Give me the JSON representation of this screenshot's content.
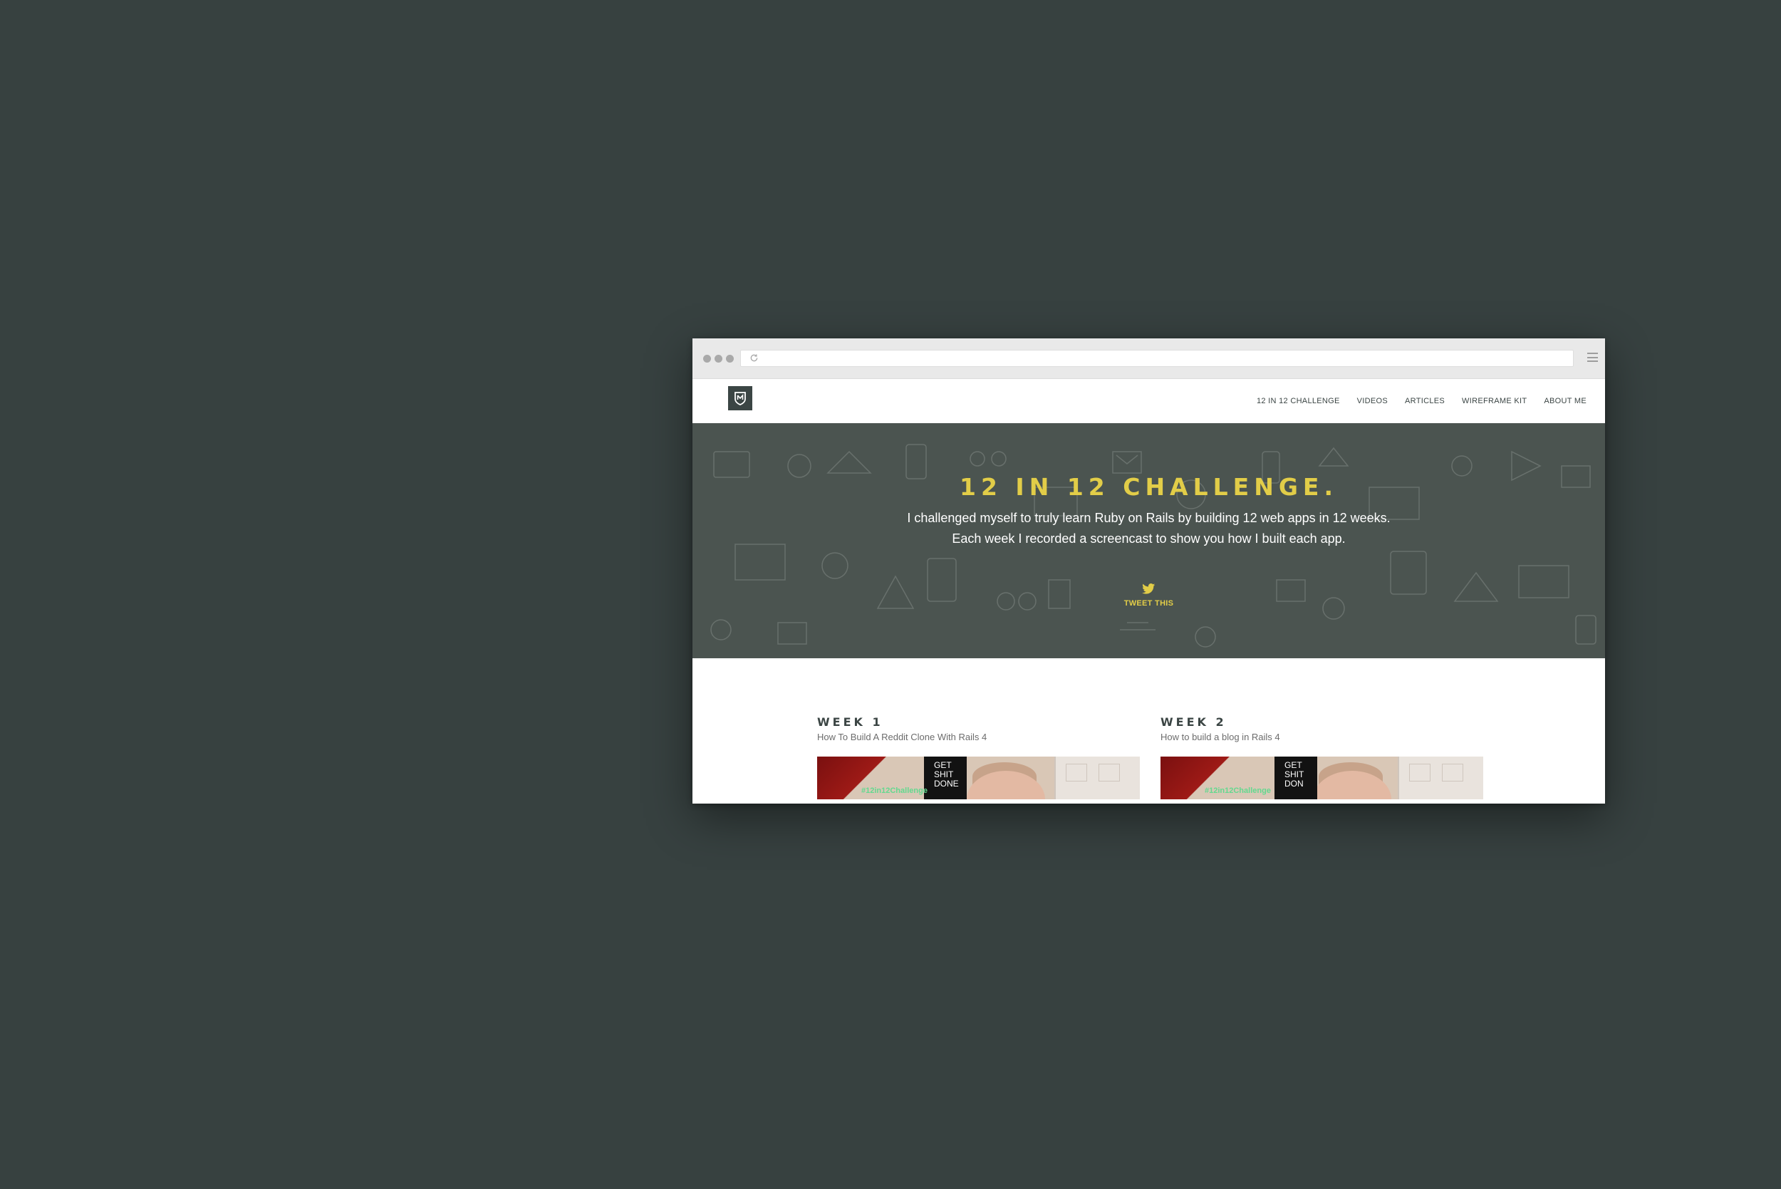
{
  "nav": {
    "items": [
      {
        "label": "12 IN 12 CHALLENGE"
      },
      {
        "label": "VIDEOS"
      },
      {
        "label": "ARTICLES"
      },
      {
        "label": "WIREFRAME KIT"
      },
      {
        "label": "ABOUT ME"
      }
    ]
  },
  "hero": {
    "title": "12 IN 12 CHALLENGE.",
    "line1": "I challenged myself to truly learn Ruby on Rails by building 12 web apps in 12 weeks.",
    "line2": "Each week I recorded a screencast to show you how I built each app.",
    "tweet_label": "TWEET THIS"
  },
  "weeks": [
    {
      "heading": "WEEK 1",
      "description": "How To Build A Reddit Clone With Rails 4",
      "thumb_tag": "#12in12Challenge",
      "thumb_poster": "GET SHIT DONE"
    },
    {
      "heading": "WEEK 2",
      "description": "How to build a blog in Rails 4",
      "thumb_tag": "#12in12Challenge",
      "thumb_poster": "GET SHIT DON"
    }
  ],
  "colors": {
    "page_bg": "#374140",
    "hero_bg": "#4b5450",
    "accent_yellow": "#e2cd48",
    "dark_text": "#3b4544"
  },
  "icons": {
    "reload": "reload-icon",
    "menu": "hamburger-icon",
    "logo": "shield-logo-icon",
    "twitter": "twitter-bird-icon"
  }
}
